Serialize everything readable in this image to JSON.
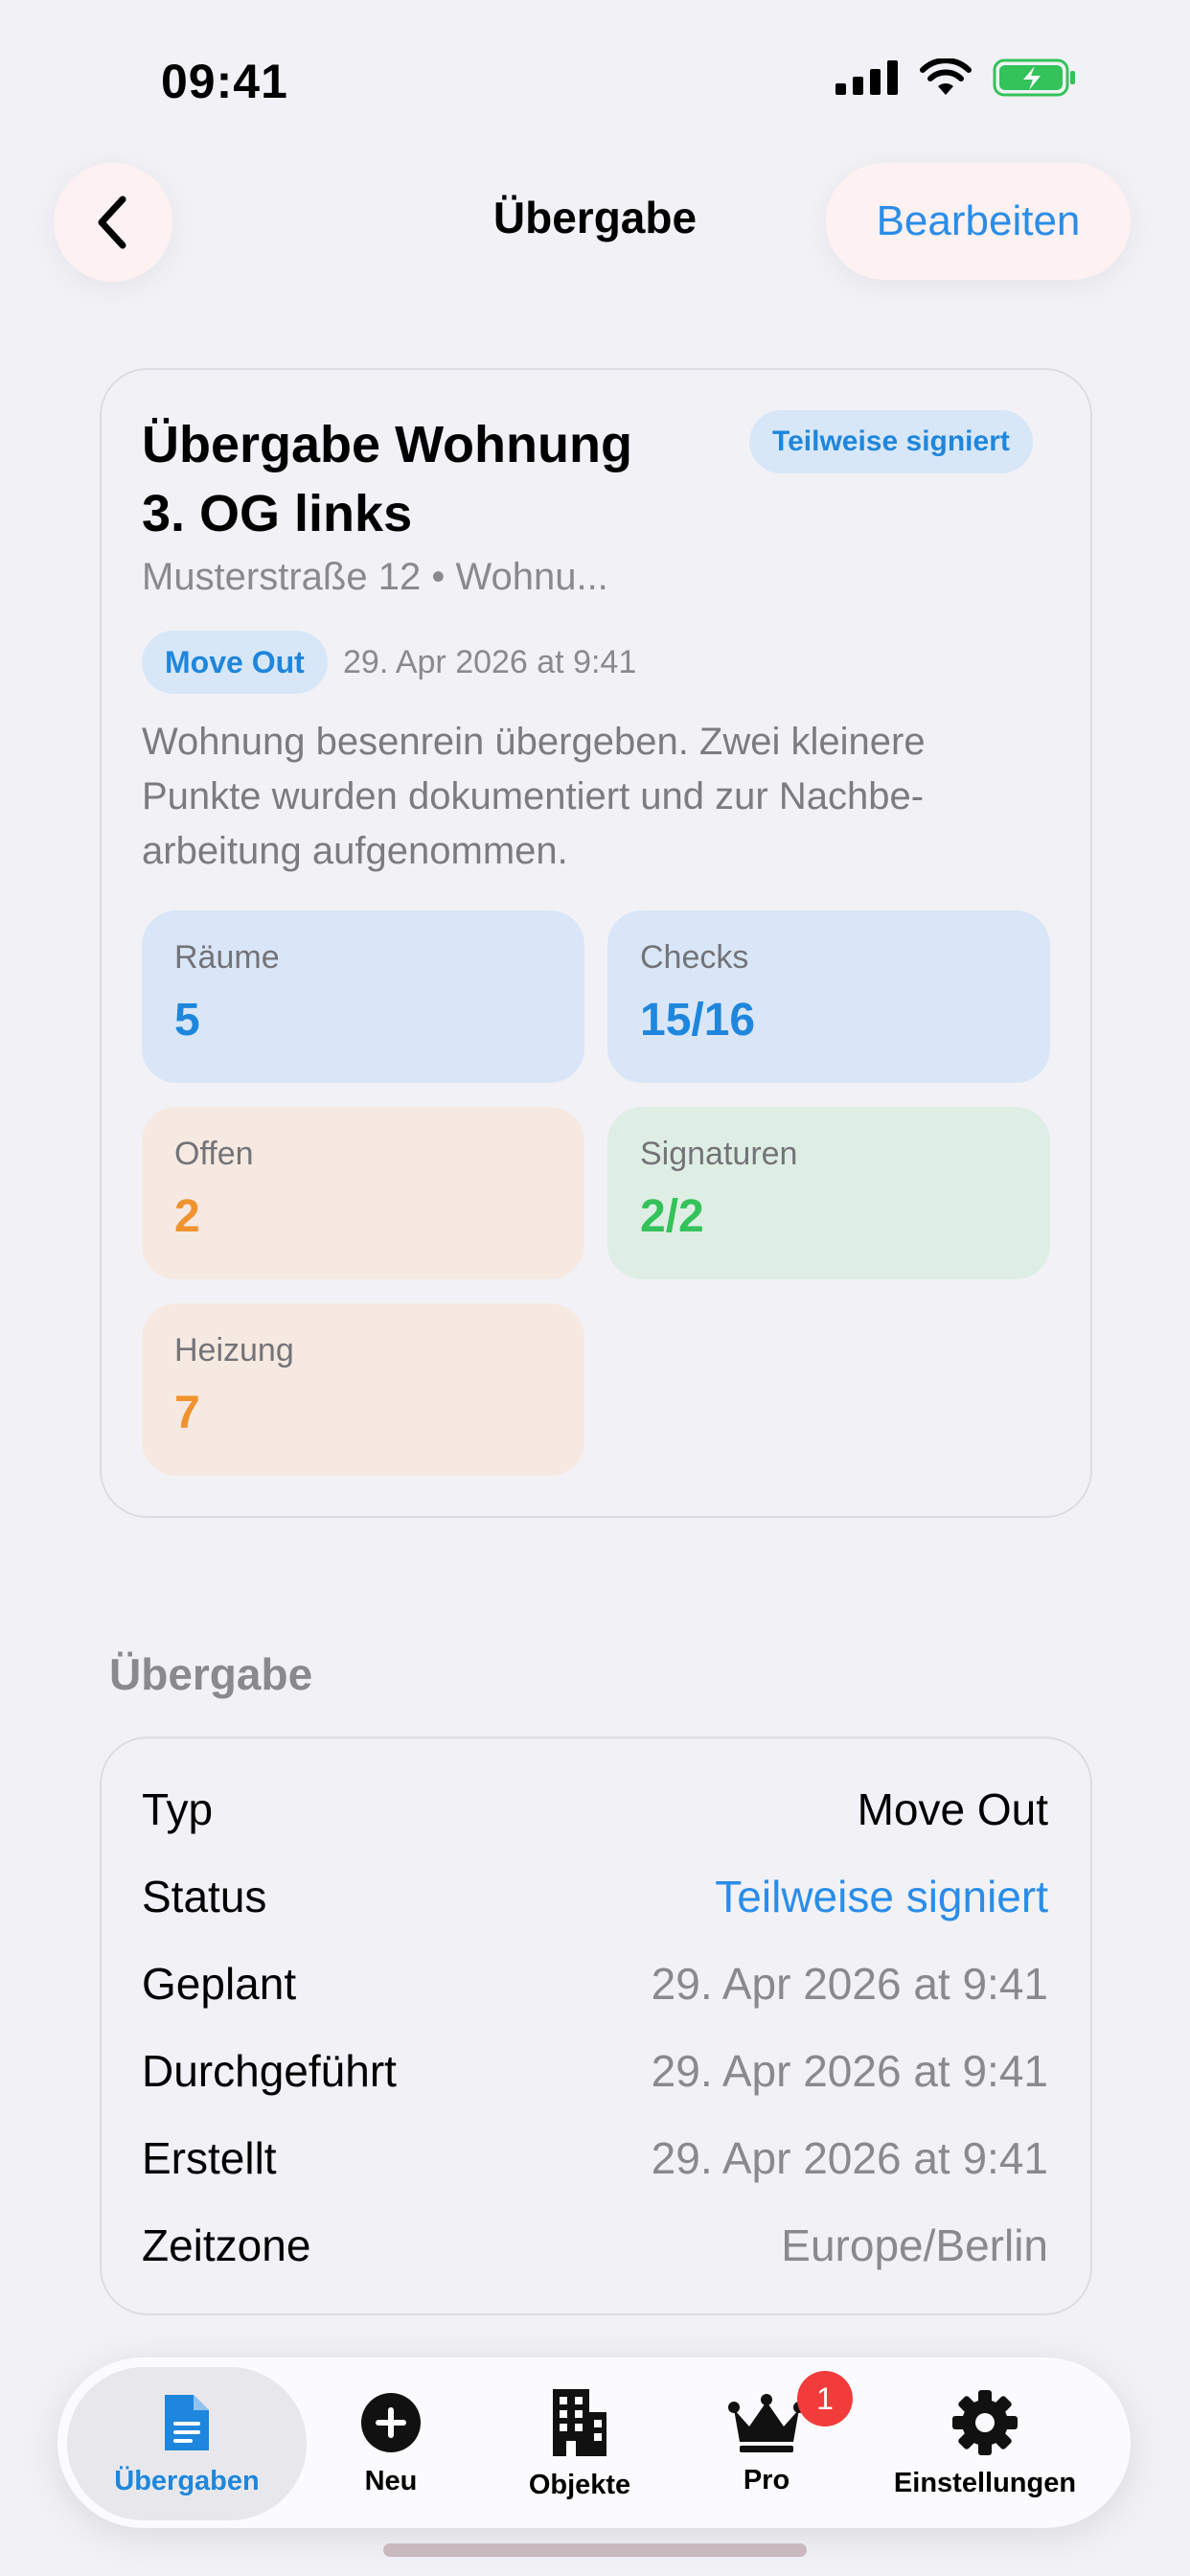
{
  "status_bar": {
    "time": "09:41"
  },
  "nav": {
    "title": "Übergabe",
    "edit_label": "Bearbeiten"
  },
  "hero": {
    "title_line1": "Übergabe Wohnung",
    "title_line2": "3. OG links",
    "status": "Teilweise signiert",
    "subtitle": "Musterstraße 12 • Wohnu...",
    "type": "Move Out",
    "date": "29. Apr 2026 at 9:41",
    "description": "Wohnung besenrein übergeben. Zwei kleinere Punkte wurden dokumentiert und zur Nachbe-arbeitung aufgenommen.",
    "stats": [
      {
        "label": "Räume",
        "value": "5"
      },
      {
        "label": "Checks",
        "value": "15/16"
      },
      {
        "label": "Offen",
        "value": "2"
      },
      {
        "label": "Signaturen",
        "value": "2/2"
      },
      {
        "label": "Heizung",
        "value": "7"
      }
    ]
  },
  "section": {
    "title": "Übergabe",
    "rows": [
      {
        "key": "Typ",
        "value": "Move Out"
      },
      {
        "key": "Status",
        "value": "Teilweise signiert"
      },
      {
        "key": "Geplant",
        "value": "29. Apr 2026 at 9:41"
      },
      {
        "key": "Durchgeführt",
        "value": "29. Apr 2026 at 9:41"
      },
      {
        "key": "Erstellt",
        "value": "29. Apr 2026 at 9:41"
      },
      {
        "key": "Zeitzone",
        "value": "Europe/Berlin"
      }
    ]
  },
  "tabbar": {
    "tabs": [
      {
        "label": "Übergaben",
        "icon": "document-icon"
      },
      {
        "label": "Neu",
        "icon": "plus-circle-icon"
      },
      {
        "label": "Objekte",
        "icon": "building-icon"
      },
      {
        "label": "Pro",
        "icon": "crown-icon"
      },
      {
        "label": "Einstellungen",
        "icon": "gear-icon"
      }
    ],
    "pro_badge": "1"
  },
  "colors": {
    "accent": "#1e86dc",
    "orange": "#f0922e",
    "green": "#34c25a"
  }
}
